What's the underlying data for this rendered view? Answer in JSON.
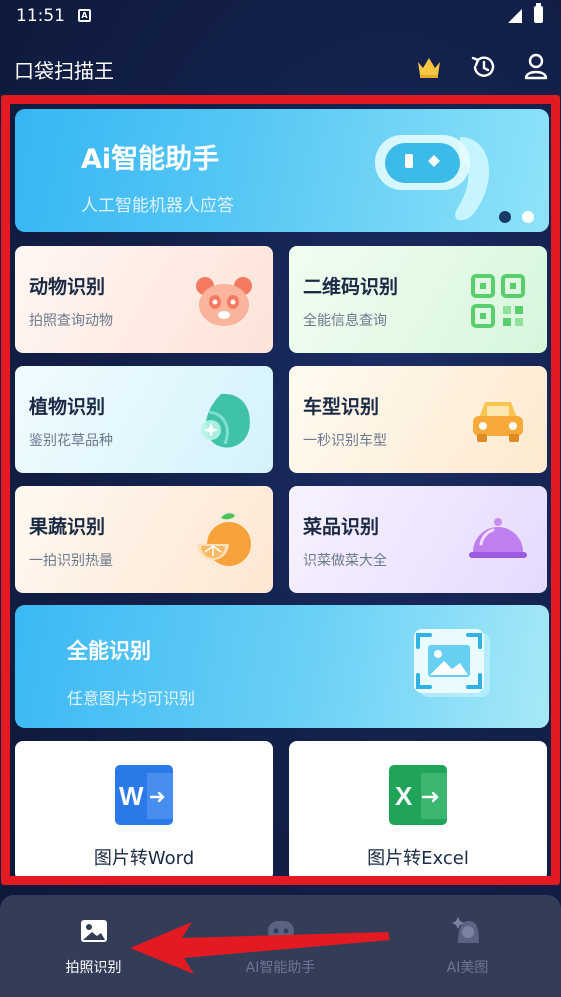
{
  "status_bar": {
    "time": "11:51",
    "notification_icon": "A"
  },
  "app": {
    "title": "口袋扫描王"
  },
  "toolbar": {
    "icons": [
      "crown-icon",
      "history-icon",
      "user-icon"
    ]
  },
  "banner": {
    "title": "Ai智能助手",
    "subtitle": "人工智能机器人应答",
    "pages": 2,
    "active_page": 1
  },
  "features": [
    {
      "title": "动物识别",
      "subtitle": "拍照查询动物",
      "icon": "panda-icon"
    },
    {
      "title": "二维码识别",
      "subtitle": "全能信息查询",
      "icon": "qr-code-icon"
    },
    {
      "title": "植物识别",
      "subtitle": "鉴别花草品种",
      "icon": "leaf-icon"
    },
    {
      "title": "车型识别",
      "subtitle": "一秒识别车型",
      "icon": "car-icon"
    },
    {
      "title": "果蔬识别",
      "subtitle": "一拍识别热量",
      "icon": "orange-icon"
    },
    {
      "title": "菜品识别",
      "subtitle": "识菜做菜大全",
      "icon": "dish-cloche-icon"
    }
  ],
  "all_round": {
    "title": "全能识别",
    "subtitle": "任意图片均可识别",
    "icon": "image-scan-icon"
  },
  "converters": [
    {
      "label": "图片转Word",
      "icon": "word-icon",
      "letter": "W"
    },
    {
      "label": "图片转Excel",
      "icon": "excel-icon",
      "letter": "X"
    }
  ],
  "bottom_nav": [
    {
      "label": "拍照识别",
      "icon": "photo-icon",
      "active": true
    },
    {
      "label": "AI智能助手",
      "icon": "robot-icon",
      "active": false
    },
    {
      "label": "AI美图",
      "icon": "portrait-icon",
      "active": false
    }
  ],
  "colors": {
    "background": "#0e1a3c",
    "annotation": "#e41a22",
    "banner": "#36b6f2",
    "nav_bg": "#343d58",
    "word": "#2b79e8",
    "excel": "#1fa45a"
  }
}
